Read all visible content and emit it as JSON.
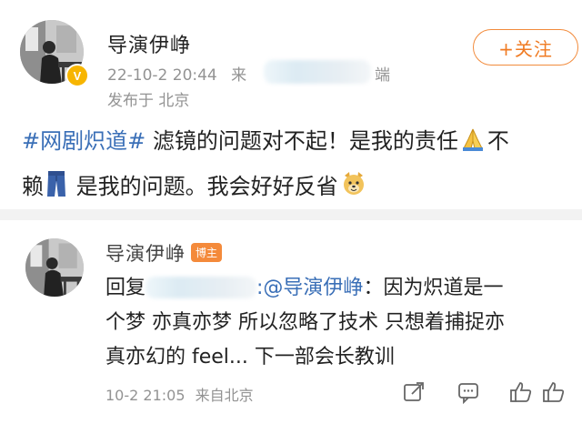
{
  "post": {
    "author": "导演伊峥",
    "time": "22-10-2 20:44",
    "source_prefix": "来",
    "source_suffix": "端",
    "location": "发布于 北京",
    "follow_label": "+关注",
    "topic": "#网剧炽道#",
    "text_part1": " 滤镜的问题对不起！是我的责任",
    "text_part2": "不",
    "text_part3": "赖",
    "text_part4": " 是我的问题。我会好好反省"
  },
  "comment": {
    "author": "导演伊峥",
    "badge": "博主",
    "reply_prefix": "回复",
    "mention": ":@导演伊峥",
    "text_line1_tail": "：因为炽道是一",
    "text_line2": "个梦 亦真亦梦 所以忽略了技术 只想着捕捉亦",
    "text_line3": "真亦幻的 feel... 下一部会长教训",
    "time": "10-2 21:05",
    "location": "来自北京"
  },
  "icons": {
    "verified": "verified-v-icon",
    "pray": "folded-hands-emoji",
    "jeans": "jeans-emoji",
    "dog": "dog-emoji",
    "share": "share-edit-icon",
    "comment": "comment-icon",
    "like": "like-thumb-icon"
  },
  "colors": {
    "topic": "#3a6fb7",
    "follow": "#f07b23",
    "verified": "#f7b500",
    "badge": "#f48a3b",
    "meta": "#939393"
  }
}
